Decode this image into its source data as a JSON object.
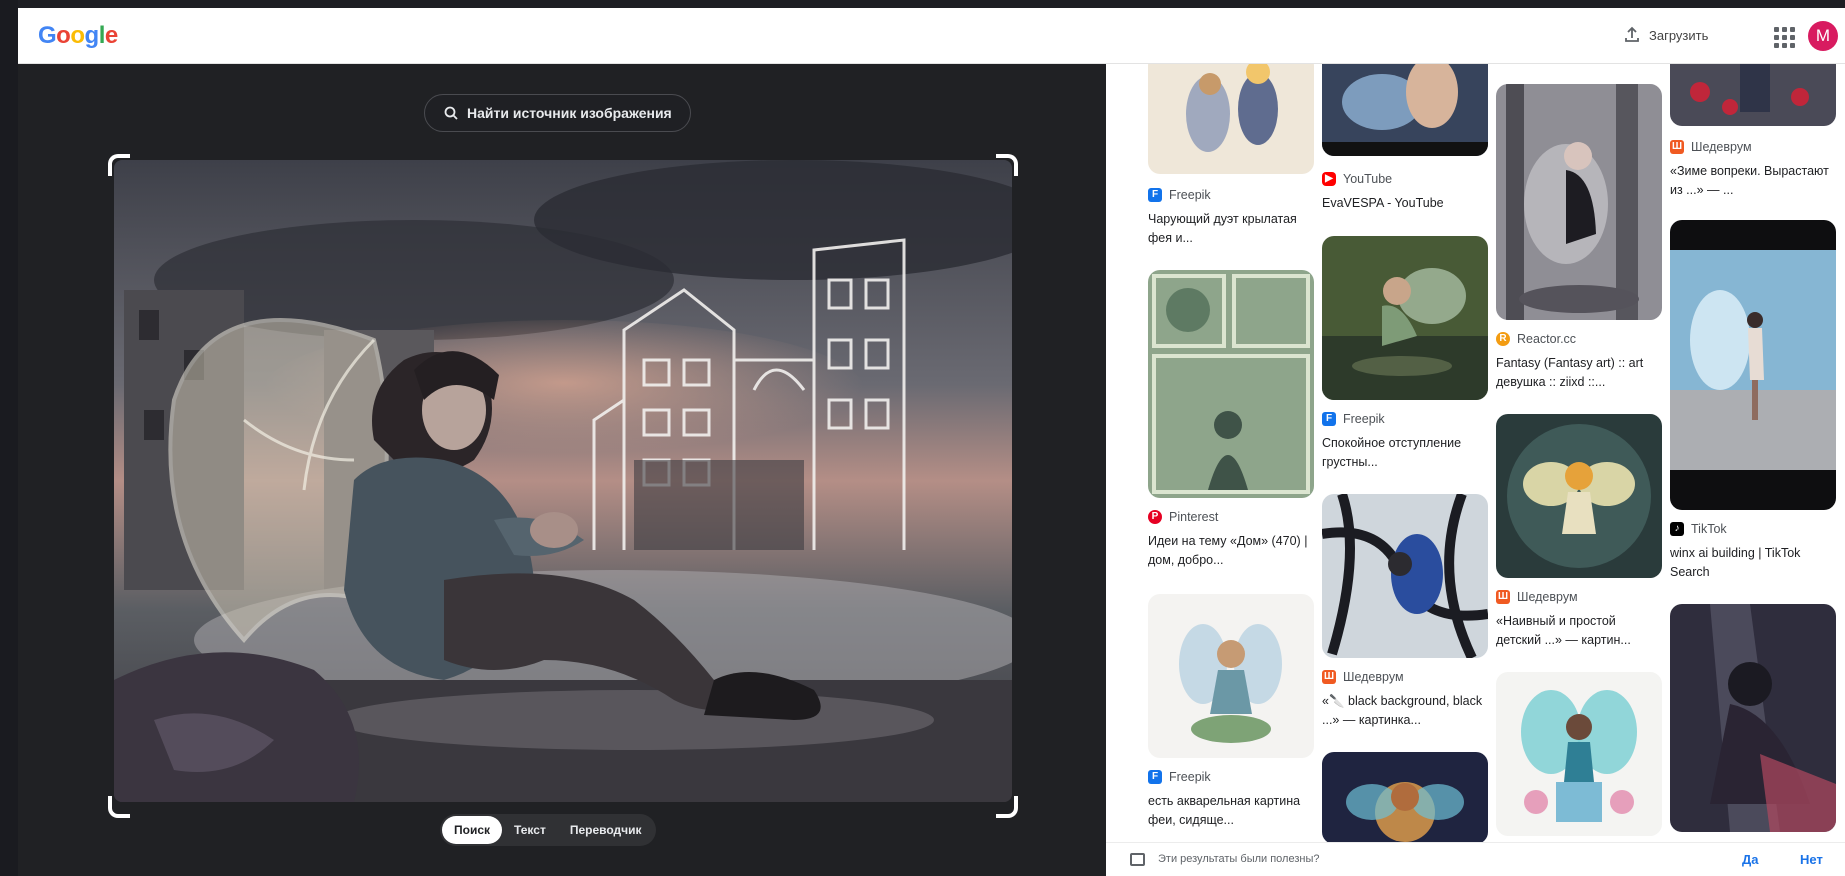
{
  "header": {
    "logo": {
      "letters": [
        "G",
        "o",
        "o",
        "g",
        "l",
        "e"
      ],
      "colors": [
        "#4285f4",
        "#ea4335",
        "#fbbc05",
        "#4285f4",
        "#34a853",
        "#ea4335"
      ]
    },
    "upload_label": "Загрузить",
    "avatar_letter": "M"
  },
  "lens": {
    "find_source_label": "Найти источник изображения",
    "modes": [
      {
        "label": "Поиск",
        "active": true
      },
      {
        "label": "Текст",
        "active": false
      },
      {
        "label": "Переводчик",
        "active": false
      }
    ]
  },
  "results": {
    "items": [
      {
        "source": "Freepik",
        "icon": "freepik-icon",
        "title": "Чарующий дуэт крылатая фея и..."
      },
      {
        "source": "Pinterest",
        "icon": "pinterest-icon",
        "title": "Идеи на тему «Дом» (470) | дом, добро..."
      },
      {
        "source": "Freepik",
        "icon": "freepik-icon",
        "title": "есть акварельная картина феи, сидяще..."
      },
      {
        "source": "YouTube",
        "icon": "youtube-icon",
        "title": "EvaVESPA - YouTube"
      },
      {
        "source": "Freepik",
        "icon": "freepik-icon",
        "title": "Спокойное отступление грустны..."
      },
      {
        "source": "Шедеврум",
        "icon": "shedevrum-icon",
        "title": "«🔪 black background, black ...» — картинка..."
      },
      {
        "source": "Reactor.cc",
        "icon": "reactor-icon",
        "title": "Fantasy (Fantasy art) :: art девушка :: ziixd ::..."
      },
      {
        "source": "Шедеврум",
        "icon": "shedevrum-icon",
        "title": "«Наивный и простой детский ...» — картин..."
      },
      {
        "source": "Шедеврум",
        "icon": "shedevrum-icon",
        "title": "«Зиме вопреки. Вырастают из ...» — ..."
      },
      {
        "source": "TikTok",
        "icon": "tiktok-icon",
        "title": "winx ai building | TikTok Search"
      }
    ],
    "feedback_question": "Эти результаты были полезны?",
    "feedback_yes": "Да",
    "feedback_no": "Нет"
  },
  "colors": {
    "freepik": "#1273eb",
    "pinterest": "#e60023",
    "youtube": "#ff0000",
    "shedevrum": "#f05a22",
    "reactor": "#f39c12",
    "tiktok": "#000000",
    "link": "#1a73e8"
  }
}
